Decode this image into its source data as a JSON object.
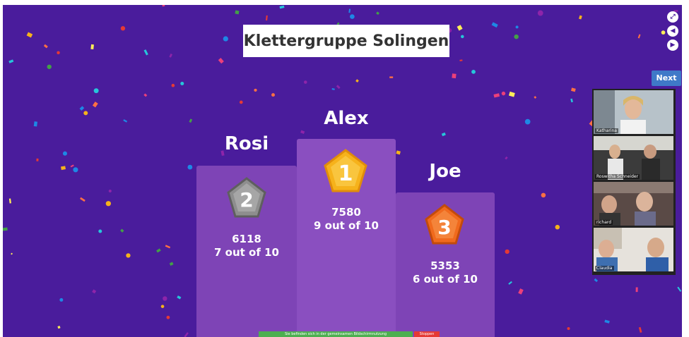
{
  "title": "Klettergruppe Solingen",
  "colors": {
    "background": "#4a1c9c",
    "podium": "#7e44b6",
    "gold": "#f6b21b",
    "silver": "#8e8e8e",
    "bronze": "#f06a1d",
    "next_button": "#3f79c8"
  },
  "podium": [
    {
      "rank": "2",
      "name": "Rosi",
      "score": "6118",
      "correct": "7 out of 10"
    },
    {
      "rank": "1",
      "name": "Alex",
      "score": "7580",
      "correct": "9 out of 10"
    },
    {
      "rank": "3",
      "name": "Joe",
      "score": "5353",
      "correct": "6 out of 10"
    }
  ],
  "controls": {
    "icons": [
      "fullscreen-icon",
      "volume-icon",
      "skip-icon"
    ],
    "next_label": "Next"
  },
  "video": {
    "participants": [
      {
        "name": "Katharina"
      },
      {
        "name": "Roswitha Schneider"
      },
      {
        "name": "richard"
      },
      {
        "name": "Claudia"
      }
    ]
  },
  "share_bar": {
    "text": "Sie befinden sich in der gemeinsamen Bildschirmnutzung",
    "stop_label": "Stoppen"
  }
}
